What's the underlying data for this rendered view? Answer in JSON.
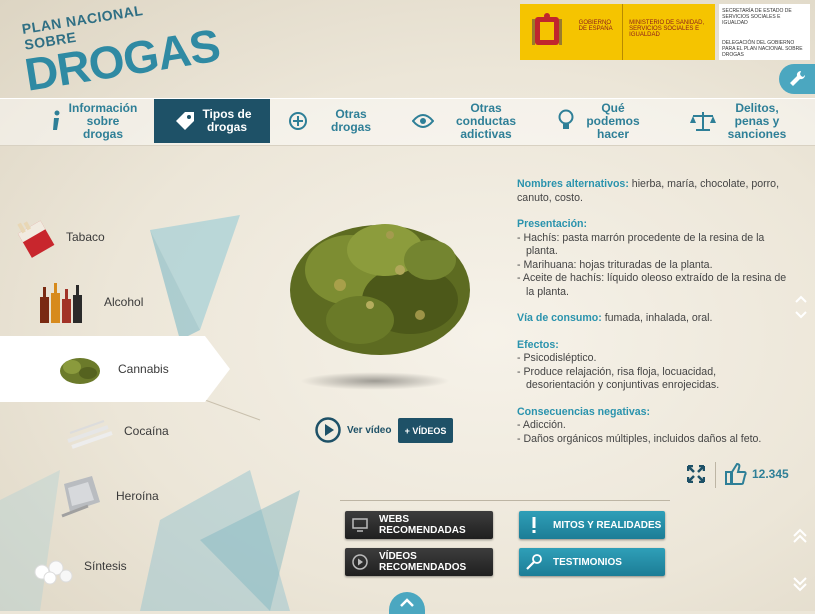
{
  "logo": {
    "line1": "PLAN NACIONAL SOBRE",
    "line2": "DROGAS"
  },
  "gov": {
    "b1": "GOBIERNO DE ESPAÑA",
    "b2": "MINISTERIO DE SANIDAD, SERVICIOS SOCIALES E IGUALDAD",
    "b3a": "SECRETARÍA DE ESTADO DE SERVICIOS SOCIALES E IGUALDAD",
    "b3b": "DELEGACIÓN DEL GOBIERNO PARA EL PLAN NACIONAL SOBRE DROGAS"
  },
  "nav": [
    {
      "label": "Información sobre drogas",
      "icon": "info-icon"
    },
    {
      "label": "Tipos de drogas",
      "icon": "tag-icon",
      "active": true
    },
    {
      "label": "Otras drogas",
      "icon": "plus-circle-icon"
    },
    {
      "label": "Otras conductas adictivas",
      "icon": "eye-icon"
    },
    {
      "label": "Qué podemos hacer",
      "icon": "lightbulb-icon"
    },
    {
      "label": "Delitos, penas y sanciones",
      "icon": "scales-icon"
    }
  ],
  "drugs": [
    {
      "label": "Tabaco"
    },
    {
      "label": "Alcohol"
    },
    {
      "label": "Cannabis",
      "active": true
    },
    {
      "label": "Cocaína"
    },
    {
      "label": "Heroína"
    },
    {
      "label": "Síntesis"
    }
  ],
  "media": {
    "video_label": "Ver vídeo",
    "videos_button": "+ VÍDEOS"
  },
  "info": {
    "alt_names_h": "Nombres alternativos:",
    "alt_names": " hierba, maría, chocolate, porro, canuto, costo.",
    "presentation_h": "Presentación:",
    "presentation": [
      "- Hachís: pasta marrón procedente de la resina de la planta.",
      "- Marihuana: hojas trituradas de la planta.",
      "- Aceite de hachís: líquido oleoso extraído de la resina de la planta."
    ],
    "route_h": "Vía de consumo:",
    "route": " fumada, inhalada, oral.",
    "effects_h": "Efectos:",
    "effects": [
      "- Psicodisléptico.",
      "- Produce relajación, risa floja,  locuacidad, desorientación y conjuntivas enrojecidas."
    ],
    "consequences_h": "Consecuencias negativas:",
    "consequences": [
      "- Adicción.",
      "- Daños orgánicos múltiples, incluidos daños al feto."
    ]
  },
  "likes": "12.345",
  "buttons": {
    "webs": "WEBS RECOMENDADAS",
    "mitos": "MITOS Y REALIDADES",
    "videos": "VÍDEOS RECOMENDADOS",
    "testimonios": "TESTIMONIOS"
  },
  "colors": {
    "teal": "#2a93ad",
    "navy": "#1e5167",
    "gold": "#f5c400"
  }
}
